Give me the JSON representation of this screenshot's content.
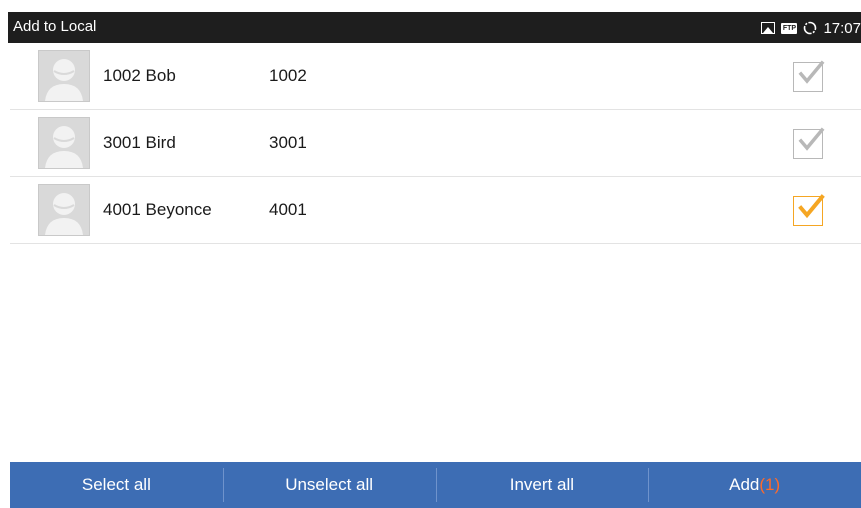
{
  "statusbar": {
    "title": "Add to Local",
    "icons": [
      "image-icon",
      "ftp-icon",
      "sync-icon"
    ],
    "ftp_label": "FTP",
    "time": "17:07"
  },
  "contacts": [
    {
      "name": "1002 Bob",
      "number": "1002",
      "checked": false
    },
    {
      "name": "3001 Bird",
      "number": "3001",
      "checked": false
    },
    {
      "name": "4001 Beyonce",
      "number": "4001",
      "checked": true
    }
  ],
  "actions": {
    "select_all": "Select all",
    "unselect_all": "Unselect all",
    "invert_all": "Invert all",
    "add_label": "Add",
    "add_count": "(1)"
  },
  "colors": {
    "statusbar_bg": "#1e1e1e",
    "bottombar_bg": "#3d6db4",
    "checked_accent": "#f5a623",
    "count_accent": "#ff6a2a"
  }
}
